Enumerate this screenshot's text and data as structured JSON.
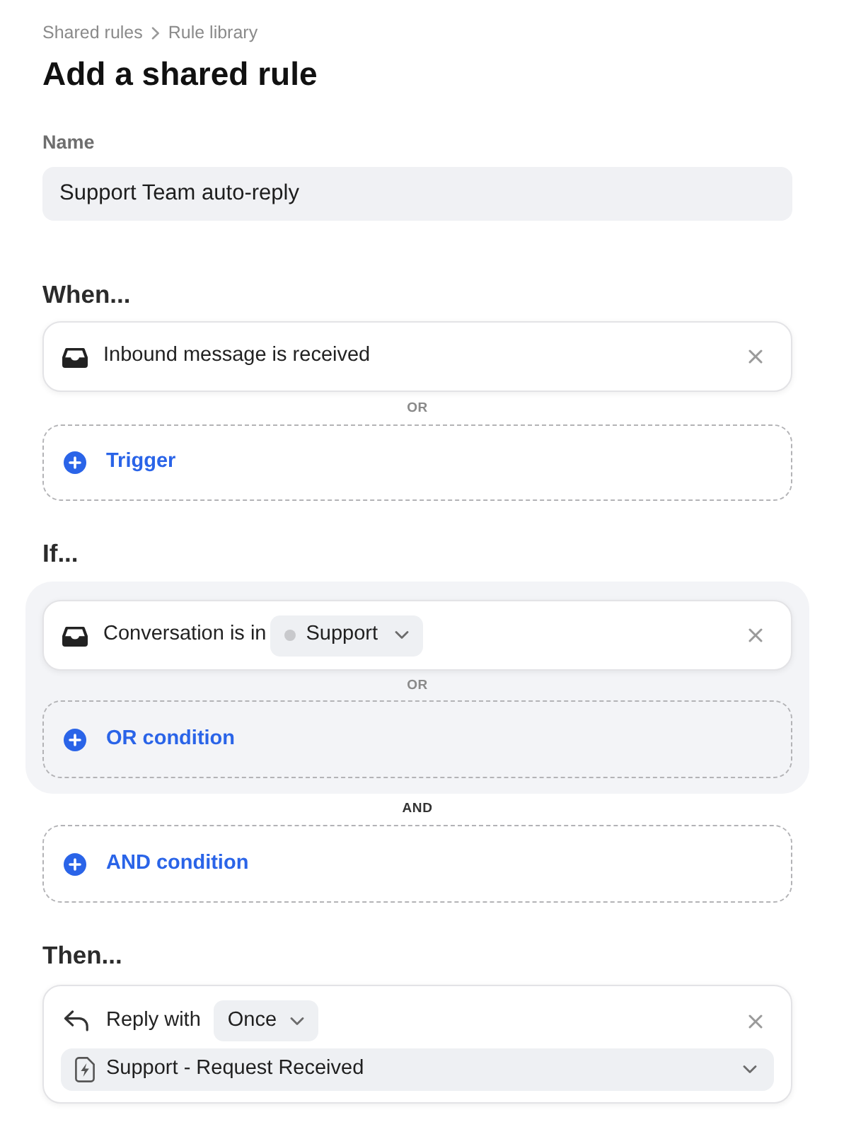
{
  "breadcrumb": [
    {
      "label": "Shared rules"
    },
    {
      "label": "Rule library"
    }
  ],
  "title": "Add a shared rule",
  "name_field": {
    "label": "Name",
    "value": "Support Team auto-reply"
  },
  "when": {
    "heading": "When...",
    "triggers": [
      {
        "text": "Inbound message is received"
      }
    ],
    "separator": "OR",
    "add_label": "Trigger"
  },
  "if": {
    "heading": "If...",
    "groups": [
      {
        "conditions": [
          {
            "text": "Conversation is in",
            "value": {
              "label": "Support",
              "color": "#c8c9cc"
            }
          }
        ],
        "separator": "OR",
        "add_label": "OR condition"
      }
    ],
    "separator": "AND",
    "add_label": "AND condition"
  },
  "then": {
    "heading": "Then...",
    "actions": [
      {
        "text": "Reply with",
        "frequency": "Once",
        "template": "Support - Request Received"
      }
    ]
  }
}
